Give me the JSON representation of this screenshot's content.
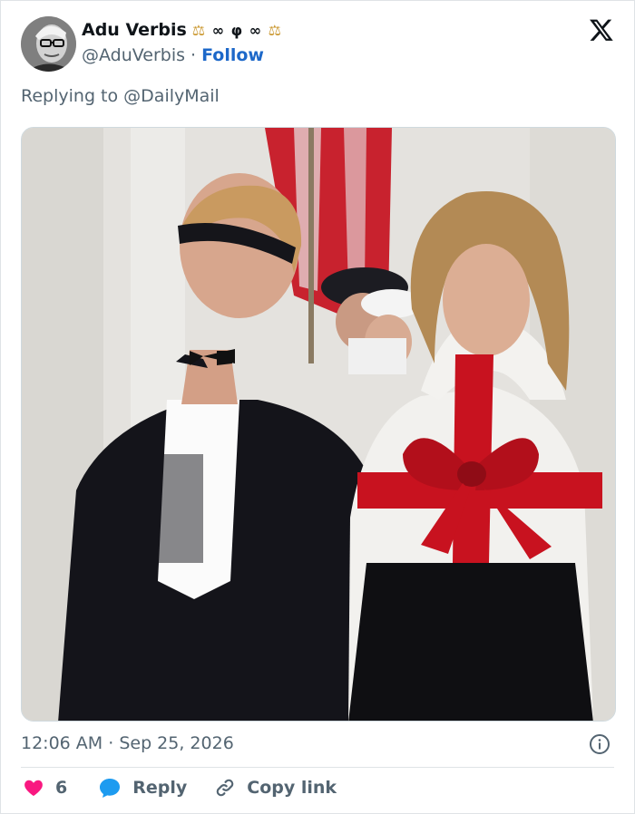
{
  "author": {
    "name": "Adu Verbis",
    "badge_glyphs": [
      "⚖",
      "∞",
      "φ",
      "∞",
      "⚖"
    ],
    "handle": "@AduVerbis",
    "separator": "·",
    "follow_label": "Follow"
  },
  "reply": {
    "prefix": "Replying to",
    "mention": "@DailyMail"
  },
  "media": {
    "icon": "photo-image"
  },
  "meta": {
    "time": "12:06 AM",
    "separator": "·",
    "date": "Sep 25, 2026"
  },
  "actions": {
    "like_count": "6",
    "reply_label": "Reply",
    "copy_label": "Copy link"
  },
  "colors": {
    "like": "#f91880",
    "reply": "#1d9bf0",
    "link": "#1d68c9",
    "muted": "#536471"
  }
}
